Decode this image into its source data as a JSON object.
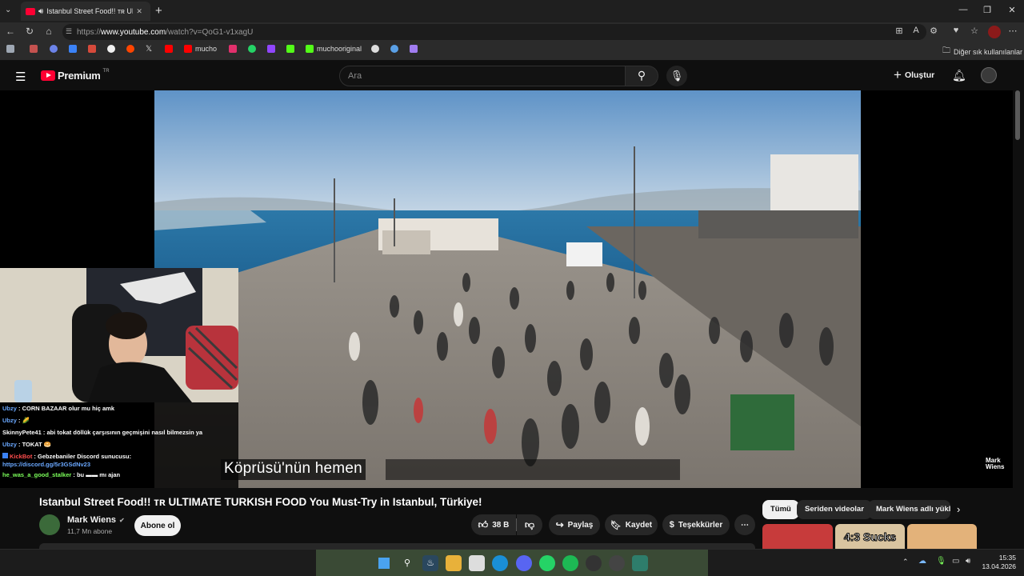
{
  "browser": {
    "tab_title": "Istanbul Street Food!! ᴛʀ ULTIMA",
    "tab_close": "✕",
    "new_tab": "+",
    "url_prefix": "https://",
    "url_domain": "www.youtube.com",
    "url_path": "/watch?v=QoG1-v1xagU",
    "bookmarks": [
      {
        "label": "",
        "color": "#9ea7b3"
      },
      {
        "label": "",
        "color": "#c4524f"
      },
      {
        "label": "",
        "color": "#6c83e8"
      },
      {
        "label": "",
        "color": "#3b82f6"
      },
      {
        "label": "",
        "color": "#d64a3b"
      },
      {
        "label": "",
        "color": "#f0f0f0"
      },
      {
        "label": "",
        "color": "#ff4500"
      },
      {
        "label": "",
        "color": "#e6e6e6"
      },
      {
        "label": "",
        "color": "#ff0000"
      },
      {
        "label": "mucho",
        "color": "#ff0000"
      },
      {
        "label": "",
        "color": "#e1306c"
      },
      {
        "label": "",
        "color": "#25d366"
      },
      {
        "label": "",
        "color": "#9146ff"
      },
      {
        "label": "",
        "color": "#53fc18"
      },
      {
        "label": "muchooriginal",
        "color": "#53fc18"
      },
      {
        "label": "",
        "color": "#dddddd"
      },
      {
        "label": "",
        "color": "#5aa0e6"
      },
      {
        "label": "",
        "color": "#a07cf0"
      }
    ],
    "other_bookmarks": "Diğer sık kullanılanlar"
  },
  "youtube": {
    "logo_text": "Premium",
    "logo_sup": "TR",
    "search_placeholder": "Ara",
    "create_label": "Oluştur"
  },
  "video": {
    "caption": "Köprüsü'nün hemen",
    "watermark": "Mark Wiens",
    "title": "Istanbul Street Food!! ᴛʀ ULTIMATE TURKISH FOOD You Must-Try in Istanbul, Türkiye!",
    "channel": "Mark Wiens",
    "subscribers": "11,7 Mn abone",
    "subscribe_label": "Abone ol",
    "likes": "38 B",
    "share_label": "Paylaş",
    "save_label": "Kaydet",
    "thanks_label": "Teşekkürler"
  },
  "chat": [
    {
      "user": "Ubzy",
      "user_color": "#6aa8ff",
      "msg": "CORN BAZAAR olur mu hiç amk"
    },
    {
      "user": "Ubzy",
      "user_color": "#6aa8ff",
      "msg": "🌽"
    },
    {
      "user": "SkinnyPete41",
      "user_color": "#ffffff",
      "msg": "abi tokat döllük çarşısının geçmişini nasıl bilmezsin ya"
    },
    {
      "user": "Ubzy",
      "user_color": "#6aa8ff",
      "msg": "TOKAT 🥯"
    },
    {
      "user": "KickBot",
      "user_color": "#ff4d4d",
      "msg": "Gebzebaniler Discord sunucusu:"
    },
    {
      "user": "",
      "user_color": "#6aa8ff",
      "msg": "https://discord.gg/5r3GSdNv23"
    },
    {
      "user": "he_was_a_good_stalker",
      "user_color": "#7cff5a",
      "msg": "bu ▬▬ mı ajan"
    }
  ],
  "sidebar_chips": [
    "Tümü",
    "Seriden videolar",
    "Mark Wiens adlı yükle"
  ],
  "thumb_text": "4:3 Sucks",
  "taskbar": {
    "time": "15:35",
    "date": "13.04.2026"
  },
  "colors": {
    "accent_red": "#ff0033",
    "youtube_bg": "#0f0f0f"
  }
}
